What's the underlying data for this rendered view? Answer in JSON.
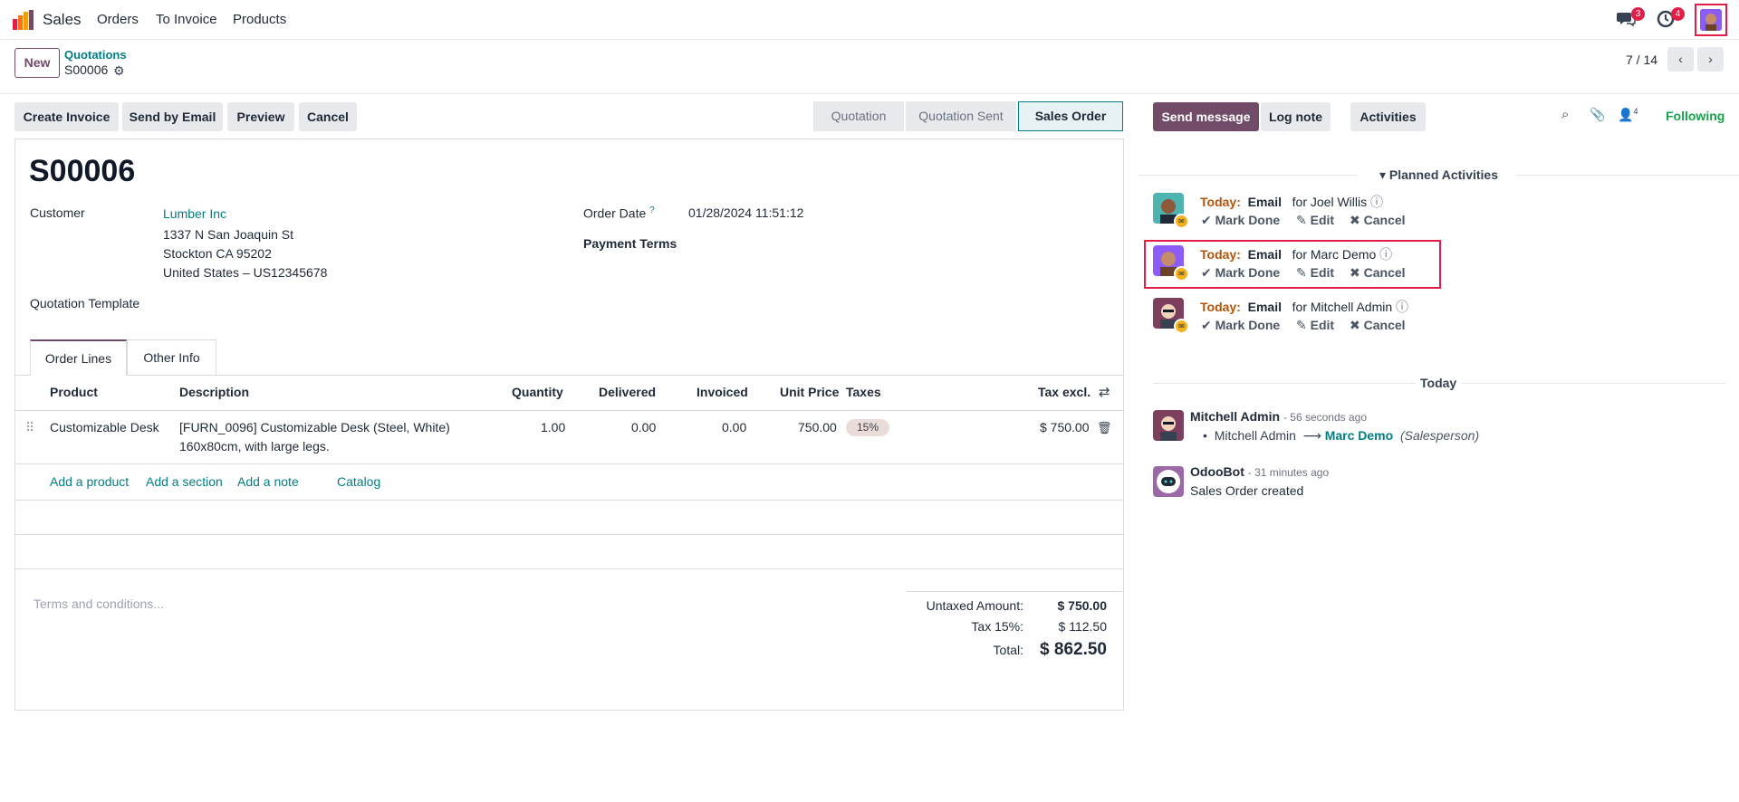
{
  "navbar": {
    "app_name": "Sales",
    "menu": [
      "Orders",
      "To Invoice",
      "Products"
    ],
    "messages_badge": "3",
    "activities_badge": "4"
  },
  "breadcrumb": {
    "parent": "Quotations",
    "current": "S00006",
    "new_label": "New"
  },
  "pager": {
    "value": "7 / 14"
  },
  "actions": {
    "create_invoice": "Create Invoice",
    "send_by_email": "Send by Email",
    "preview": "Preview",
    "cancel": "Cancel"
  },
  "stages": [
    "Quotation",
    "Quotation Sent",
    "Sales Order"
  ],
  "form": {
    "title": "S00006",
    "customer_label": "Customer",
    "customer_name": "Lumber Inc",
    "address_line1": "1337 N San Joaquin St",
    "address_line2": "Stockton CA 95202",
    "address_line3": "United States – US12345678",
    "quotation_template_label": "Quotation Template",
    "order_date_label": "Order Date",
    "order_date_help": "?",
    "order_date_value": "01/28/2024 11:51:12",
    "payment_terms_label": "Payment Terms"
  },
  "tabs": [
    "Order Lines",
    "Other Info"
  ],
  "table": {
    "headers": [
      "Product",
      "Description",
      "Quantity",
      "Delivered",
      "Invoiced",
      "Unit Price",
      "Taxes",
      "Tax excl."
    ],
    "rows": [
      {
        "product": "Customizable Desk",
        "description_line1": "[FURN_0096] Customizable Desk (Steel, White)",
        "description_line2": "160x80cm, with large legs.",
        "quantity": "1.00",
        "delivered": "0.00",
        "invoiced": "0.00",
        "unit_price": "750.00",
        "taxes": "15%",
        "subtotal": "$ 750.00"
      }
    ],
    "add_links": [
      "Add a product",
      "Add a section",
      "Add a note",
      "Catalog"
    ]
  },
  "terms_placeholder": "Terms and conditions...",
  "totals": {
    "untaxed_label": "Untaxed Amount:",
    "untaxed_value": "$ 750.00",
    "tax_label": "Tax 15%:",
    "tax_value": "$ 112.50",
    "total_label": "Total:",
    "total_value": "$ 862.50"
  },
  "chatter": {
    "send_message": "Send message",
    "log_note": "Log note",
    "activities": "Activities",
    "followers_count": "4",
    "following": "Following",
    "planned_title": "Planned Activities",
    "activities_list": [
      {
        "when": "Today:",
        "type": "Email",
        "for": "for Joel Willis",
        "mark_done": "Mark Done",
        "edit": "Edit",
        "cancel": "Cancel"
      },
      {
        "when": "Today:",
        "type": "Email",
        "for": "for Marc Demo",
        "mark_done": "Mark Done",
        "edit": "Edit",
        "cancel": "Cancel"
      },
      {
        "when": "Today:",
        "type": "Email",
        "for": "for Mitchell Admin",
        "mark_done": "Mark Done",
        "edit": "Edit",
        "cancel": "Cancel"
      }
    ],
    "date_separator": "Today",
    "messages": [
      {
        "author": "Mitchell Admin",
        "time": "- 56 seconds ago",
        "tracking_from": "Mitchell Admin",
        "tracking_to": "Marc Demo",
        "tracking_field": "(Salesperson)"
      },
      {
        "author": "OdooBot",
        "time": "- 31 minutes ago",
        "body": "Sales Order created"
      }
    ]
  },
  "colors": {
    "brand": "#714b67",
    "link": "#017e84",
    "badge": "#e11d48",
    "today": "#b45309",
    "following": "#16a34a"
  }
}
